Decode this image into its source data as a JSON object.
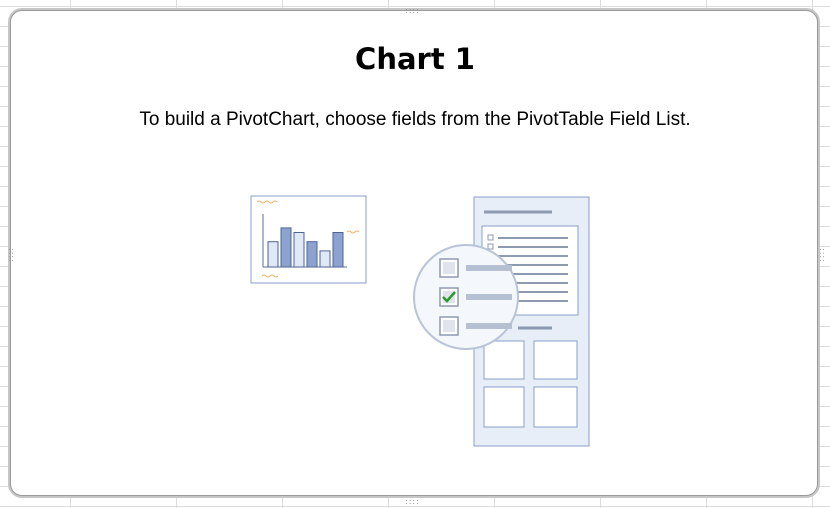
{
  "chart": {
    "title": "Chart 1",
    "instructions": "To build a PivotChart, choose fields from the PivotTable Field List."
  },
  "illustration": {
    "bar_values": [
      0.55,
      0.85,
      0.75,
      0.55,
      0.35,
      0.75
    ],
    "colors": {
      "accent_orange": "#f0b068",
      "bar_dark": "#8da3cf",
      "bar_light": "#dfe8f6",
      "panel_fill": "#e8eef8",
      "panel_border": "#8a9ec8",
      "check_green": "#2e9a2e"
    },
    "checkboxes": [
      false,
      true,
      false
    ]
  }
}
